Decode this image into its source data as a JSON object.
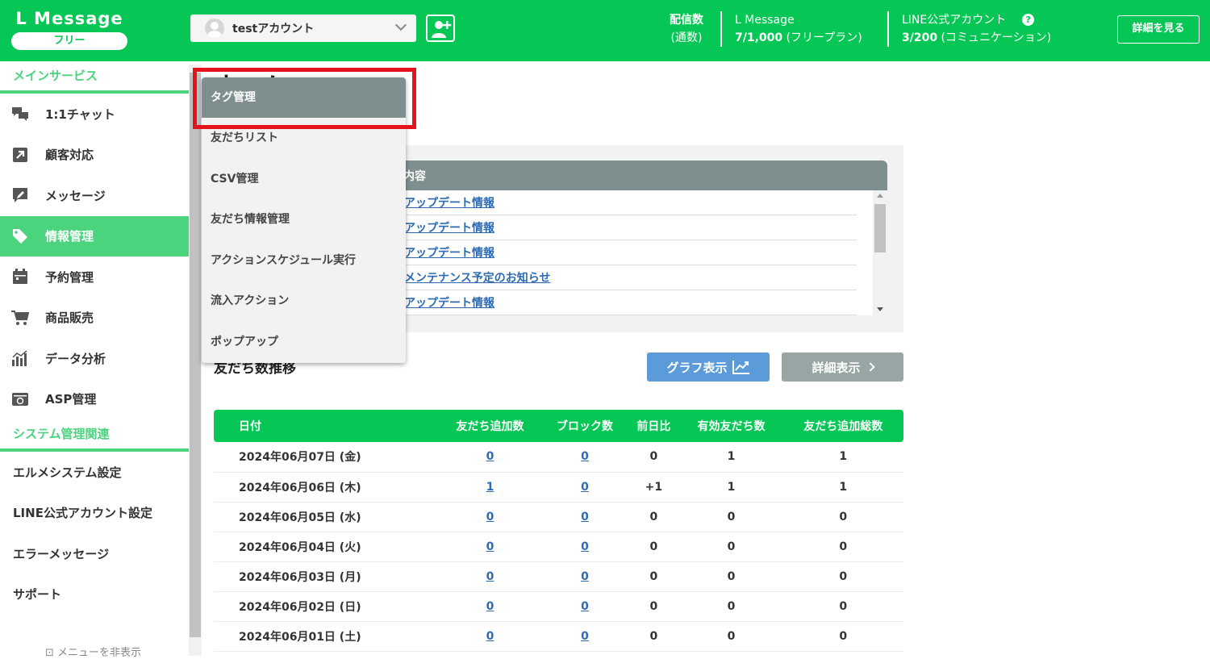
{
  "header": {
    "brand": "L Message",
    "plan_badge": "フリー",
    "account": "testアカウント",
    "stats": {
      "send_label": "配信数",
      "send_sub": "(通数)",
      "lmessage_label": "L Message",
      "lmessage_value": "7/1,000",
      "lmessage_plan": "(フリープラン)",
      "line_label": "LINE公式アカウント",
      "line_value": "3/200",
      "line_plan": "(コミュニケーション)"
    },
    "details_button": "詳細を見る"
  },
  "sidebar": {
    "main_section": "メインサービス",
    "main_items": [
      {
        "label": "1:1チャット",
        "icon": "chat-icon"
      },
      {
        "label": "顧客対応",
        "icon": "arrow-box-icon"
      },
      {
        "label": "メッセージ",
        "icon": "message-icon"
      },
      {
        "label": "情報管理",
        "icon": "tag-icon",
        "active": true
      },
      {
        "label": "予約管理",
        "icon": "calendar-icon"
      },
      {
        "label": "商品販売",
        "icon": "cart-icon"
      },
      {
        "label": "データ分析",
        "icon": "bar-chart-icon"
      },
      {
        "label": "ASP管理",
        "icon": "asp-icon"
      }
    ],
    "system_section": "システム管理関連",
    "system_items": [
      "エルメシステム設定",
      "LINE公式アカウント設定",
      "エラーメッセージ",
      "サポート"
    ],
    "footer": "メニューを非表示"
  },
  "main": {
    "page_title": "ホーム",
    "news": {
      "header": "内容",
      "rows": [
        "アップデート情報",
        "アップデート情報",
        "アップデート情報",
        "メンテナンス予定のお知らせ",
        "アップデート情報"
      ]
    },
    "friends_section": "友だち数推移",
    "graph_button": "グラフ表示",
    "detail_button": "詳細表示",
    "table": {
      "headers": [
        "日付",
        "友だち追加数",
        "ブロック数",
        "前日比",
        "有効友だち数",
        "友だち追加総数"
      ],
      "rows": [
        [
          "2024年06月07日 (金)",
          "0",
          "0",
          "0",
          "1",
          "1"
        ],
        [
          "2024年06月06日 (木)",
          "1",
          "0",
          "+1",
          "1",
          "1"
        ],
        [
          "2024年06月05日 (水)",
          "0",
          "0",
          "0",
          "0",
          "0"
        ],
        [
          "2024年06月04日 (火)",
          "0",
          "0",
          "0",
          "0",
          "0"
        ],
        [
          "2024年06月03日 (月)",
          "0",
          "0",
          "0",
          "0",
          "0"
        ],
        [
          "2024年06月02日 (日)",
          "0",
          "0",
          "0",
          "0",
          "0"
        ],
        [
          "2024年06月01日 (土)",
          "0",
          "0",
          "0",
          "0",
          "0"
        ]
      ]
    }
  },
  "dropdown": {
    "items": [
      "タグ管理",
      "友だちリスト",
      "CSV管理",
      "友だち情報管理",
      "アクションスケジュール実行",
      "流入アクション",
      "ポップアップ"
    ],
    "selected_index": 0
  },
  "colors": {
    "brand_green": "#06c755",
    "sidebar_green": "#4cd37e",
    "highlight_red": "#e5141c",
    "link_blue": "#2e6bb3"
  }
}
